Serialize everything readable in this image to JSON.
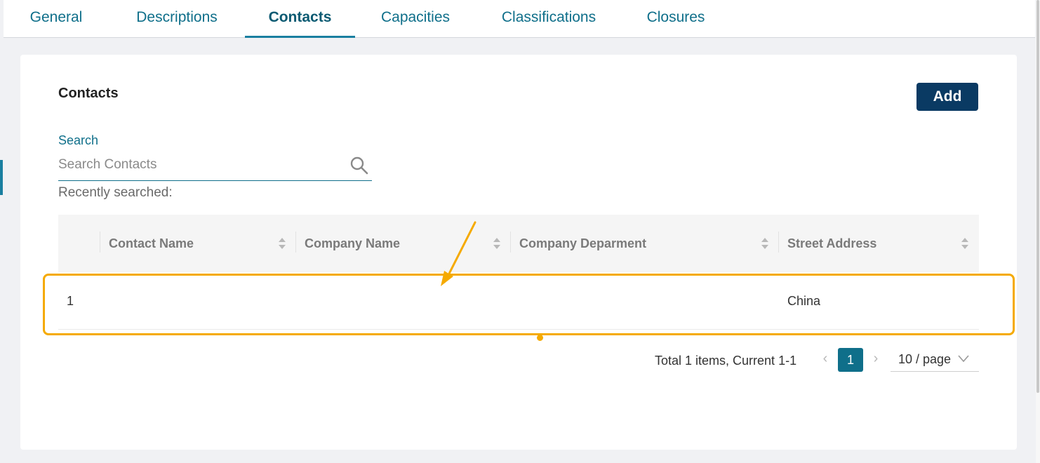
{
  "tabs": [
    {
      "label": "General"
    },
    {
      "label": "Descriptions"
    },
    {
      "label": "Contacts",
      "active": true
    },
    {
      "label": "Capacities"
    },
    {
      "label": "Classifications"
    },
    {
      "label": "Closures"
    }
  ],
  "contacts": {
    "title": "Contacts",
    "add_label": "Add",
    "search": {
      "label": "Search",
      "placeholder": "Search Contacts",
      "value": "",
      "recent_label": "Recently searched:"
    },
    "table": {
      "columns": [
        "Contact Name",
        "Company Name",
        "Company Deparment",
        "Street Address"
      ],
      "rows": [
        {
          "index": "1",
          "contact_name": "",
          "company_name": "",
          "company_department": "",
          "street_address": "China"
        }
      ]
    },
    "pagination": {
      "total_text": "Total 1 items, Current 1-1",
      "current_page": "1",
      "page_size": "10 / page"
    }
  },
  "colors": {
    "accent": "#0f6f8a",
    "primary_button": "#0a3a63",
    "highlight": "#f5aa00"
  }
}
